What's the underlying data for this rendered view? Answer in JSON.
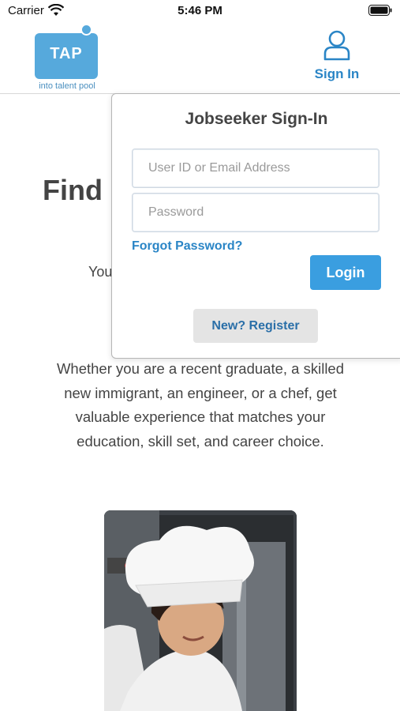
{
  "status_bar": {
    "carrier": "Carrier",
    "time": "5:46 PM",
    "icons": [
      "wifi-icon",
      "battery-icon"
    ]
  },
  "header": {
    "logo": {
      "text": "TAP",
      "subtitle": "into talent pool",
      "color": "#56a9dc"
    },
    "signin": {
      "label": "Sign In",
      "icon": "user-icon",
      "color": "#2a85c6"
    }
  },
  "main": {
    "hero_title_visible": "Find",
    "hero_fragment_visible": "You",
    "description": "Whether you are a recent graduate, a skilled new immigrant, an engineer, or a chef, get valuable experience that matches your education, skill set, and career choice.",
    "photo": "chef-photo"
  },
  "signin_popup": {
    "title": "Jobseeker Sign-In",
    "user_field": {
      "value": "",
      "placeholder": "User ID or Email Address"
    },
    "password_field": {
      "value": "",
      "placeholder": "Password"
    },
    "forgot_label": "Forgot Password?",
    "login_label": "Login",
    "register_label": "New? Register",
    "accent_color": "#3a9ee0"
  }
}
